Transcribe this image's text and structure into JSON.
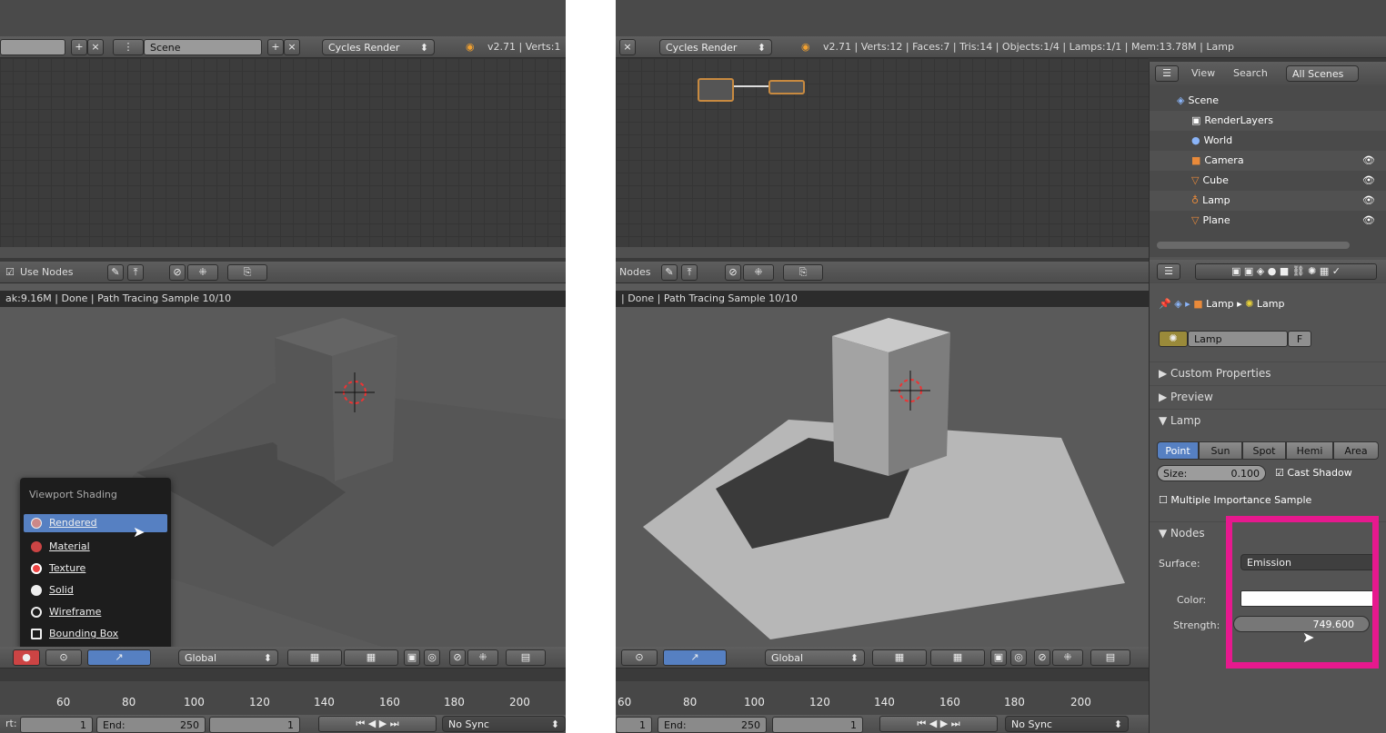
{
  "left": {
    "header": {
      "scene_name": "Scene",
      "render_engine": "Cycles Render",
      "stats": "v2.71 | Verts:1"
    },
    "node_header": {
      "use_nodes": "Use Nodes"
    },
    "viewport": {
      "info": "ak:9.16M | Done | Path Tracing Sample 10/10"
    },
    "shading_menu": {
      "title": "Viewport Shading",
      "items": [
        "Rendered",
        "Material",
        "Texture",
        "Solid",
        "Wireframe",
        "Bounding Box"
      ],
      "selected": "Rendered"
    },
    "footer": {
      "orientation": "Global"
    },
    "timeline": {
      "ticks": [
        "60",
        "80",
        "100",
        "120",
        "140",
        "160",
        "180",
        "200"
      ],
      "start_label": "rt:",
      "start_value": "1",
      "end_label": "End:",
      "end_value": "250",
      "current_frame": "1",
      "sync": "No Sync"
    }
  },
  "right": {
    "header": {
      "render_engine": "Cycles Render",
      "stats": "v2.71 | Verts:12 | Faces:7 | Tris:14 | Objects:1/4 | Lamps:1/1 | Mem:13.78M | Lamp"
    },
    "node_header": {
      "use_nodes": "Nodes"
    },
    "viewport": {
      "info": "| Done | Path Tracing Sample 10/10"
    },
    "footer": {
      "orientation": "Global"
    },
    "timeline": {
      "ticks": [
        "60",
        "80",
        "100",
        "120",
        "140",
        "160",
        "180",
        "200"
      ],
      "start_value": "1",
      "end_label": "End:",
      "end_value": "250",
      "current_frame": "1",
      "sync": "No Sync"
    },
    "outliner": {
      "menu_view": "View",
      "menu_search": "Search",
      "filter": "All Scenes",
      "items": [
        "Scene",
        "RenderLayers",
        "World",
        "Camera",
        "Cube",
        "Lamp",
        "Plane"
      ]
    },
    "properties": {
      "breadcrumb_object": "Lamp",
      "breadcrumb_data": "Lamp",
      "datablock_name": "Lamp",
      "datablock_fake": "F",
      "sections": {
        "custom": "Custom Properties",
        "preview": "Preview",
        "lamp": "Lamp",
        "nodes": "Nodes"
      },
      "lamp_types": [
        "Point",
        "Sun",
        "Spot",
        "Hemi",
        "Area"
      ],
      "active_lamp_type": "Point",
      "size_label": "Size:",
      "size_value": "0.100",
      "cast_shadow": "Cast Shadow",
      "mis": "Multiple Importance Sample",
      "surface_label": "Surface:",
      "surface_value": "Emission",
      "color_label": "Color:",
      "color_value": "#ffffff",
      "strength_label": "Strength:",
      "strength_value": "749.600"
    }
  },
  "colors": {
    "highlight": "#e6198e",
    "selection": "#5680c2"
  }
}
